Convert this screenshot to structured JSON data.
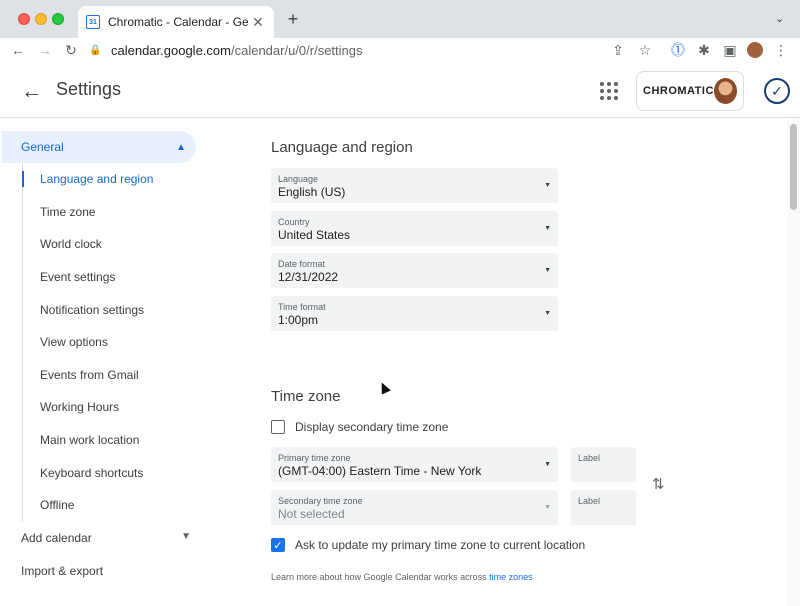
{
  "browser": {
    "tab_title": "Chromatic - Calendar - Genera",
    "tab_favicon_text": "31",
    "url_host": "calendar.google.com",
    "url_path": "/calendar/u/0/r/settings"
  },
  "header": {
    "title": "Settings",
    "account_brand": "CHROMATIC"
  },
  "sidebar": {
    "general_label": "General",
    "items": [
      {
        "label": "Language and region",
        "active": true
      },
      {
        "label": "Time zone"
      },
      {
        "label": "World clock"
      },
      {
        "label": "Event settings"
      },
      {
        "label": "Notification settings"
      },
      {
        "label": "View options"
      },
      {
        "label": "Events from Gmail"
      },
      {
        "label": "Working Hours"
      },
      {
        "label": "Main work location"
      },
      {
        "label": "Keyboard shortcuts"
      },
      {
        "label": "Offline"
      }
    ],
    "add_calendar": "Add calendar",
    "import_export": "Import & export"
  },
  "language_region": {
    "title": "Language and region",
    "language": {
      "label": "Language",
      "value": "English (US)"
    },
    "country": {
      "label": "Country",
      "value": "United States"
    },
    "date_format": {
      "label": "Date format",
      "value": "12/31/2022"
    },
    "time_format": {
      "label": "Time format",
      "value": "1:00pm"
    }
  },
  "time_zone": {
    "title": "Time zone",
    "secondary_checkbox_label": "Display secondary time zone",
    "secondary_checked": false,
    "primary": {
      "label": "Primary time zone",
      "value": "(GMT-04:00) Eastern Time - New York"
    },
    "primary_label_placeholder": "Label",
    "secondary": {
      "label": "Secondary time zone",
      "value": "Not selected"
    },
    "secondary_label_placeholder": "Label",
    "ask_update_label": "Ask to update my primary time zone to current location",
    "ask_update_checked": true,
    "help_prefix": "Learn more about how Google Calendar works across",
    "help_link": "time zones"
  },
  "colors": {
    "accent": "#1a73e8",
    "active_nav_bg": "#e8f0fe",
    "field_bg": "#f1f3f4"
  }
}
